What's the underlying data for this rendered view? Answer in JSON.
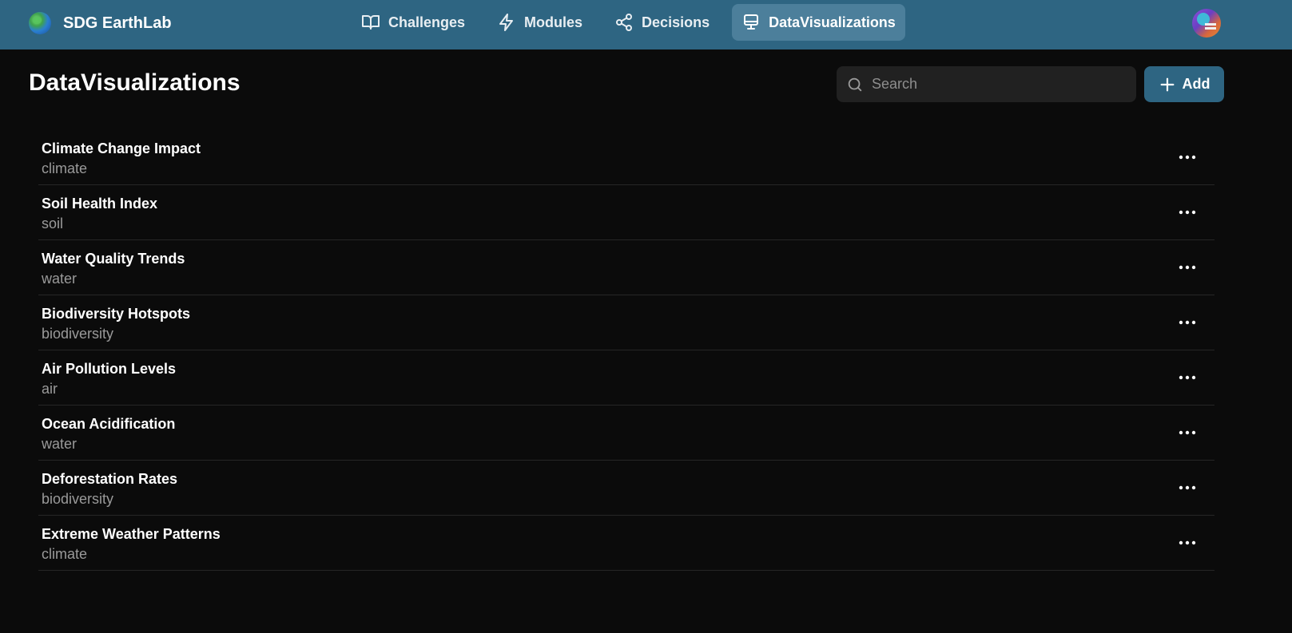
{
  "app": {
    "name": "SDG EarthLab"
  },
  "nav": {
    "items": [
      {
        "label": "Challenges",
        "icon": "book-open-icon",
        "active": false
      },
      {
        "label": "Modules",
        "icon": "lightning-icon",
        "active": false
      },
      {
        "label": "Decisions",
        "icon": "share-nodes-icon",
        "active": false
      },
      {
        "label": "DataVisualizations",
        "icon": "monitor-icon",
        "active": true
      }
    ]
  },
  "page": {
    "title": "DataVisualizations"
  },
  "search": {
    "placeholder": "Search",
    "value": ""
  },
  "toolbar": {
    "add_label": "Add"
  },
  "list": {
    "items": [
      {
        "title": "Climate Change Impact",
        "category": "climate"
      },
      {
        "title": "Soil Health Index",
        "category": "soil"
      },
      {
        "title": "Water Quality Trends",
        "category": "water"
      },
      {
        "title": "Biodiversity Hotspots",
        "category": "biodiversity"
      },
      {
        "title": "Air Pollution Levels",
        "category": "air"
      },
      {
        "title": "Ocean Acidification",
        "category": "water"
      },
      {
        "title": "Deforestation Rates",
        "category": "biodiversity"
      },
      {
        "title": "Extreme Weather Patterns",
        "category": "climate"
      }
    ]
  },
  "colors": {
    "topbar": "#2e6582",
    "nav_active": "#4c7f9b",
    "background": "#0b0b0b",
    "search_bg": "#212121",
    "subtext": "#9a9a9a"
  }
}
